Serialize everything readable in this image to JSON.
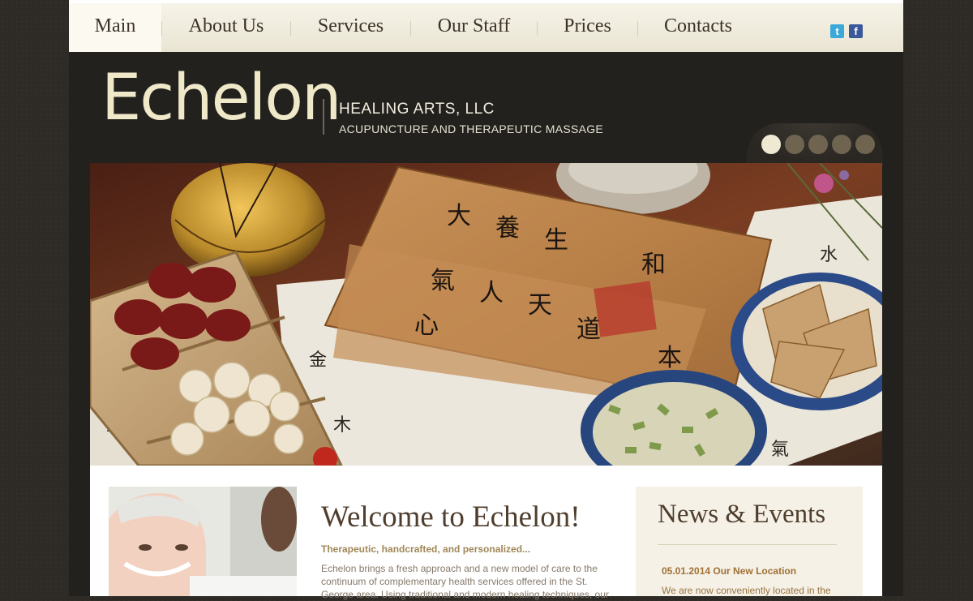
{
  "nav": {
    "items": [
      {
        "label": "Main",
        "active": true
      },
      {
        "label": "About Us"
      },
      {
        "label": "Services"
      },
      {
        "label": "Our Staff"
      },
      {
        "label": "Prices"
      },
      {
        "label": "Contacts"
      }
    ],
    "social": [
      "twitter-icon",
      "facebook-icon"
    ]
  },
  "header": {
    "logo": "Echelon",
    "tagline1": "HEALING ARTS, LLC",
    "tagline2": "ACUPUNCTURE AND THERAPEUTIC MASSAGE"
  },
  "slider": {
    "count": 5,
    "active_index": 0
  },
  "hero": {
    "calligraphy": [
      "大",
      "養",
      "生",
      "氣",
      "人",
      "天",
      "心",
      "道",
      "和",
      "本"
    ]
  },
  "welcome": {
    "title": "Welcome to Echelon!",
    "subtitle": "Therapeutic, handcrafted, and personalized...",
    "body": "Echelon brings a fresh approach and a new model of care to the continuum of complementary health services offered in the St. George area. Using traditional and modern healing techniques, our"
  },
  "news": {
    "title": "News & Events",
    "item_date_title": "05.01.2014 Our New Location",
    "item_body": "We are now conveniently located in the"
  },
  "colors": {
    "page_bg": "#2e2b27",
    "nav_bg": "#f1eddf",
    "heading": "#4f3e2d",
    "accent": "#a07033"
  }
}
